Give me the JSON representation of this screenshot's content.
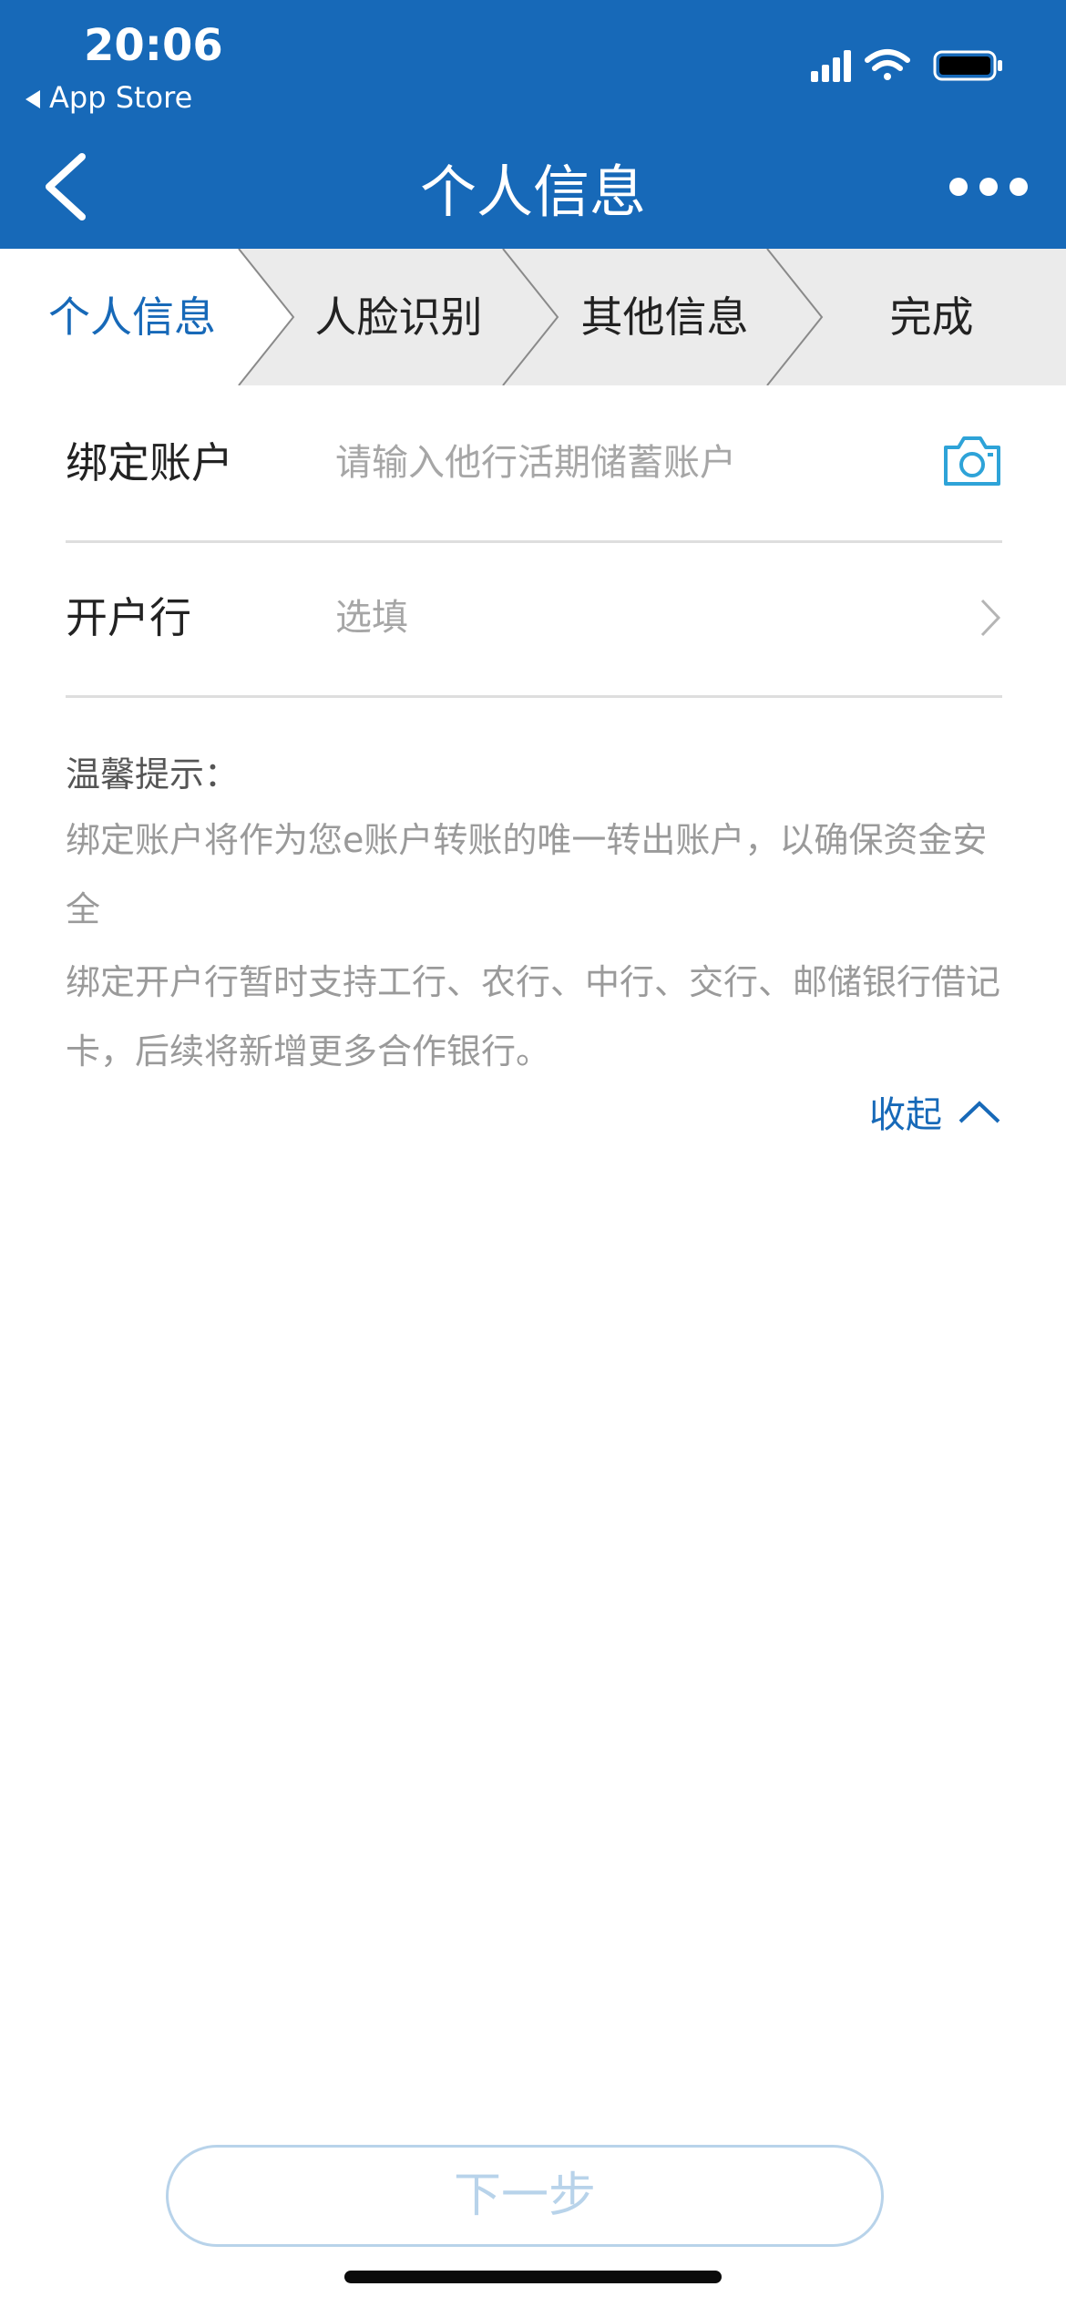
{
  "status_bar": {
    "time": "20:06",
    "back_app": "App Store"
  },
  "nav": {
    "title": "个人信息"
  },
  "steps": [
    "个人信息",
    "人脸识别",
    "其他信息",
    "完成"
  ],
  "colors": {
    "brand": "#1769b8",
    "step_bg": "#ebebeb",
    "disabled_button": "#b8d3ea"
  },
  "form": {
    "account_label": "绑定账户",
    "account_placeholder": "请输入他行活期储蓄账户",
    "bank_label": "开户行",
    "bank_placeholder": "选填"
  },
  "tips": {
    "title": "温馨提示：",
    "line1": "绑定账户将作为您e账户转账的唯一转出账户，以确保资金安全",
    "line2": "绑定开户行暂时支持工行、农行、中行、交行、邮储银行借记卡，后续将新增更多合作银行。",
    "collapse_label": "收起"
  },
  "next_button": "下一步"
}
